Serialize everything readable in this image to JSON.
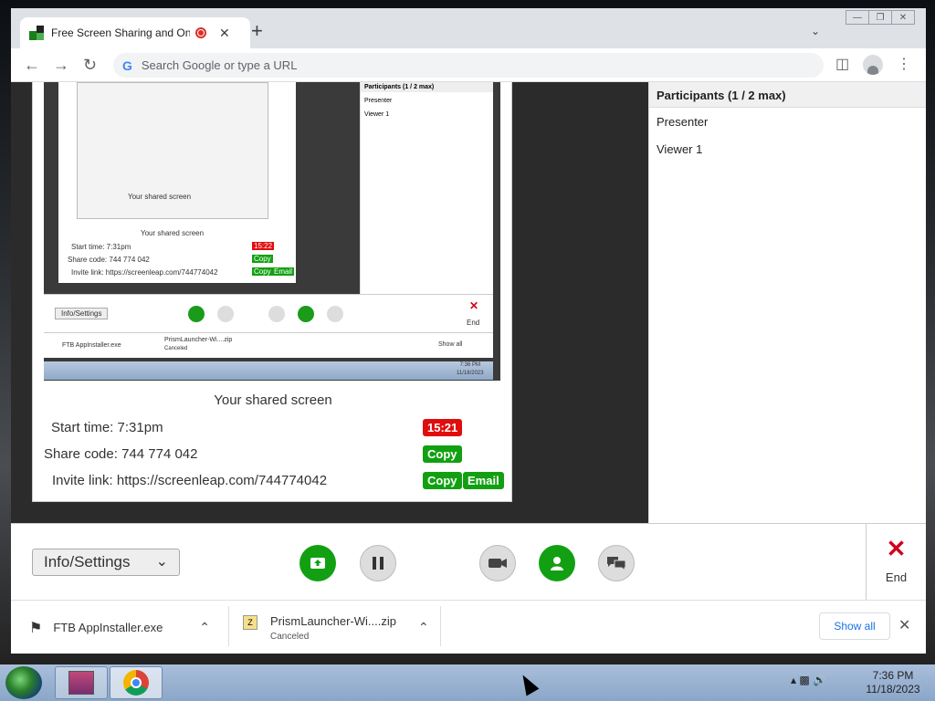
{
  "browser": {
    "tab_title": "Free Screen Sharing and Online Meetings",
    "new_tab": "+",
    "tab_close": "✕",
    "omnibox_placeholder": "Search Google or type a URL",
    "window_controls": [
      "—",
      "❐",
      "✕"
    ]
  },
  "preview": {
    "participants_header": "Participants (1 / 2 max)",
    "participants": [
      "Presenter",
      "Viewer 1"
    ],
    "shared_label": "Your shared screen",
    "start_time": "Start time: 7:31pm",
    "share_code": "Share code: 744 774 042",
    "invite": "Invite link: https://screenleap.com/744774042",
    "timer": "15:22",
    "copy": "Copy",
    "email": "Email",
    "info_settings": "Info/Settings",
    "end": "End",
    "dl1": "FTB AppInstaller.exe",
    "dl2": "PrismLauncher-Wi....zip",
    "dl2_sub": "Canceled",
    "show_all": "Show all",
    "clock": "7:36 PM",
    "date": "11/18/2023"
  },
  "shared": {
    "label": "Your shared screen",
    "start_time_label": "Start time:",
    "start_time": "7:31pm",
    "share_code_label": "Share code:",
    "share_code": "744 774 042",
    "invite_label": "Invite link:",
    "invite_link": "https://screenleap.com/744774042",
    "timer": "15:21",
    "copy_label": "Copy",
    "email_label": "Email"
  },
  "participants": {
    "header": "Participants (1 / 2 max)",
    "items": [
      "Presenter",
      "Viewer 1"
    ]
  },
  "controls": {
    "info_settings": "Info/Settings",
    "end_label": "End"
  },
  "downloads": {
    "items": [
      {
        "name": "FTB AppInstaller.exe",
        "status": ""
      },
      {
        "name": "PrismLauncher-Wi....zip",
        "status": "Canceled"
      }
    ],
    "show_all": "Show all"
  },
  "taskbar": {
    "time": "7:36 PM",
    "date": "11/18/2023"
  },
  "colors": {
    "accent_green": "#12a012",
    "timer_red": "#e00d0d",
    "end_red": "#d0021b"
  }
}
